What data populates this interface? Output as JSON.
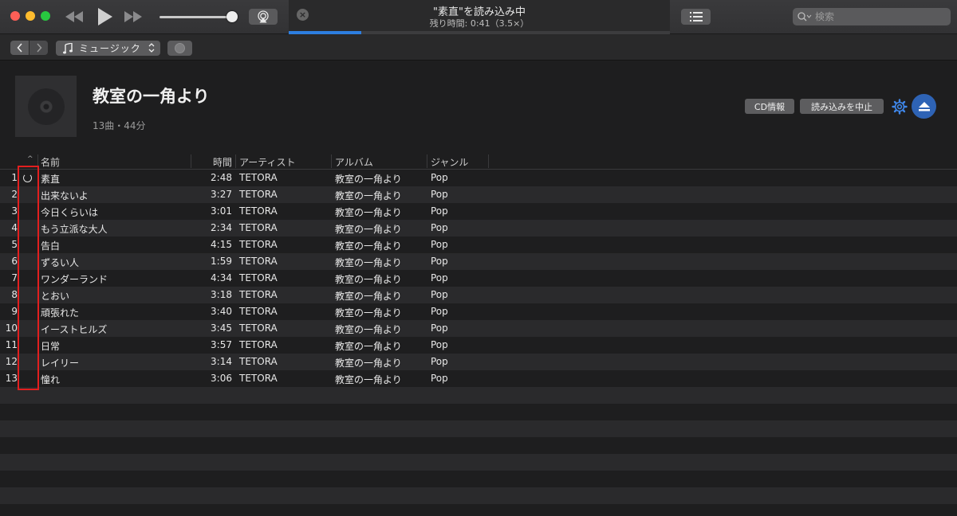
{
  "window": {
    "lcd": {
      "title": "\"素直\"を読み込み中",
      "subtitle": "残り時間: 0:41（3.5×）",
      "progress_percent": 19
    },
    "search_placeholder": "検索",
    "volume_percent": 92
  },
  "toolbar": {
    "media_kind": "ミュージック"
  },
  "album": {
    "title": "教室の一角より",
    "meta": "13曲・44分",
    "cd_info_label": "CD情報",
    "stop_import_label": "読み込みを中止"
  },
  "table": {
    "columns": {
      "name": "名前",
      "time": "時間",
      "artist": "アーティスト",
      "album": "アルバム",
      "genre": "ジャンル"
    },
    "tracks": [
      {
        "num": "1",
        "name": "素直",
        "time": "2:48",
        "artist": "TETORA",
        "album": "教室の一角より",
        "genre": "Pop"
      },
      {
        "num": "2",
        "name": "出来ないよ",
        "time": "3:27",
        "artist": "TETORA",
        "album": "教室の一角より",
        "genre": "Pop"
      },
      {
        "num": "3",
        "name": "今日くらいは",
        "time": "3:01",
        "artist": "TETORA",
        "album": "教室の一角より",
        "genre": "Pop"
      },
      {
        "num": "4",
        "name": "もう立派な大人",
        "time": "2:34",
        "artist": "TETORA",
        "album": "教室の一角より",
        "genre": "Pop"
      },
      {
        "num": "5",
        "name": "告白",
        "time": "4:15",
        "artist": "TETORA",
        "album": "教室の一角より",
        "genre": "Pop"
      },
      {
        "num": "6",
        "name": "ずるい人",
        "time": "1:59",
        "artist": "TETORA",
        "album": "教室の一角より",
        "genre": "Pop"
      },
      {
        "num": "7",
        "name": "ワンダーランド",
        "time": "4:34",
        "artist": "TETORA",
        "album": "教室の一角より",
        "genre": "Pop"
      },
      {
        "num": "8",
        "name": "とおい",
        "time": "3:18",
        "artist": "TETORA",
        "album": "教室の一角より",
        "genre": "Pop"
      },
      {
        "num": "9",
        "name": "頑張れた",
        "time": "3:40",
        "artist": "TETORA",
        "album": "教室の一角より",
        "genre": "Pop"
      },
      {
        "num": "10",
        "name": "イーストヒルズ",
        "time": "3:45",
        "artist": "TETORA",
        "album": "教室の一角より",
        "genre": "Pop"
      },
      {
        "num": "11",
        "name": "日常",
        "time": "3:57",
        "artist": "TETORA",
        "album": "教室の一角より",
        "genre": "Pop"
      },
      {
        "num": "12",
        "name": "レイリー",
        "time": "3:14",
        "artist": "TETORA",
        "album": "教室の一角より",
        "genre": "Pop"
      },
      {
        "num": "13",
        "name": "憧れ",
        "time": "3:06",
        "artist": "TETORA",
        "album": "教室の一角より",
        "genre": "Pop"
      }
    ],
    "importing_track_index": 0
  },
  "colors": {
    "accent": "#2d7ee0",
    "eject": "#2e63b5",
    "highlight_box": "#e21f1f"
  }
}
